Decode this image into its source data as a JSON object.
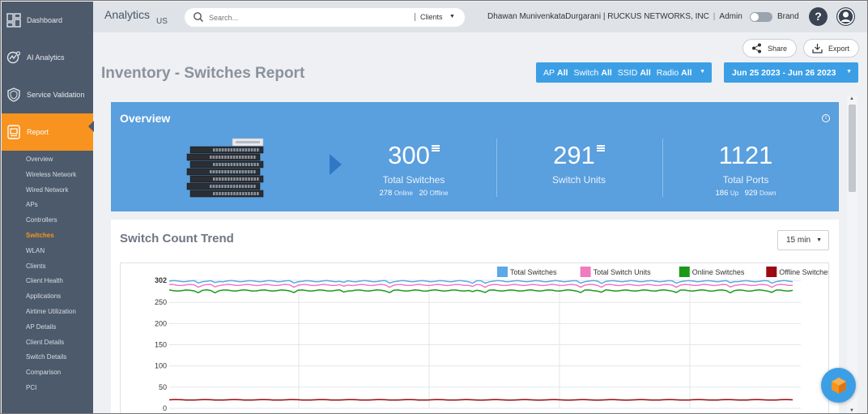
{
  "sidebar": {
    "main": [
      {
        "label": "Dashboard",
        "icon": "dashboard-icon"
      },
      {
        "label": "AI Analytics",
        "icon": "ai-analytics-icon"
      },
      {
        "label": "Service Validation",
        "icon": "shield-icon"
      },
      {
        "label": "Report",
        "icon": "report-icon",
        "active": true
      }
    ],
    "report_items": [
      "Overview",
      "Wireless Network",
      "Wired Network",
      "APs",
      "Controllers",
      "Switches",
      "WLAN",
      "Clients",
      "Client Health",
      "Applications",
      "Airtime Utilization",
      "AP Details",
      "Client Details",
      "Switch Details",
      "Comparison",
      "PCI"
    ],
    "active_report_item": "Switches"
  },
  "header": {
    "app_title": "Analytics",
    "region": "US",
    "search_placeholder": "Search...",
    "search_scope": "Clients",
    "user_account": "Dhawan MunivenkataDurgarani | RUCKUS NETWORKS, INC",
    "role": "Admin",
    "brand_label": "Brand",
    "help_symbol": "?"
  },
  "actions": {
    "share": "Share",
    "export": "Export"
  },
  "page": {
    "title": "Inventory - Switches Report"
  },
  "filters": {
    "items": [
      {
        "name": "AP",
        "value": "All"
      },
      {
        "name": "Switch",
        "value": "All"
      },
      {
        "name": "SSID",
        "value": "All"
      },
      {
        "name": "Radio",
        "value": "All"
      }
    ],
    "date_range": "Jun 25 2023 - Jun 26 2023"
  },
  "overview": {
    "title": "Overview",
    "total_switches": {
      "value": "300",
      "label": "Total Switches",
      "online": "278",
      "online_label": "Online",
      "offline": "20",
      "offline_label": "Offline"
    },
    "switch_units": {
      "value": "291",
      "label": "Switch Units"
    },
    "total_ports": {
      "value": "1121",
      "label": "Total Ports",
      "up": "186",
      "up_label": "Up",
      "down": "929",
      "down_label": "Down"
    }
  },
  "trend": {
    "title": "Switch Count Trend",
    "interval": "15 min"
  },
  "chart_data": {
    "type": "line",
    "title": "",
    "xlabel": "",
    "ylabel": "",
    "ylim": [
      0,
      302
    ],
    "yticks": [
      0,
      50,
      100,
      150,
      200,
      250,
      302
    ],
    "legend_position": "top-right",
    "grid": true,
    "series": [
      {
        "name": "Total Switches",
        "color": "#5aaae6",
        "level": 300
      },
      {
        "name": "Total Switch Units",
        "color": "#f07cc0",
        "level": 291
      },
      {
        "name": "Online Switches",
        "color": "#1a9a1a",
        "level": 278
      },
      {
        "name": "Offline Switches",
        "color": "#9b0a10",
        "level": 20
      }
    ]
  },
  "colors": {
    "accent": "#3c9fe6",
    "sidebar": "#4d5a6b",
    "active_nav": "#f7931e",
    "overview_bg": "#5a9fde"
  }
}
